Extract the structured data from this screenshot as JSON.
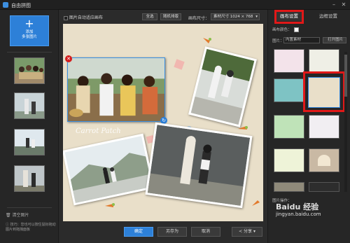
{
  "window": {
    "title": "自由拼图",
    "controls": [
      "minimize",
      "close"
    ]
  },
  "left_panel": {
    "add_button": {
      "icon": "plus-icon",
      "label": "添加\n多张图片"
    },
    "thumbnails": [
      "photo-group",
      "photo-statue-1",
      "photo-statue-2",
      "photo-statue-3"
    ],
    "clear_button": "清空图片",
    "tip": "技巧：您也可以按住鼠标拖动图片到拖拽面板"
  },
  "toolbar": {
    "auto_fill_checkbox": "图片自动适应画布",
    "select_all": "全选",
    "random_layout": "随机排版",
    "canvas_size_label": "画布尺寸：",
    "canvas_size_value": "素材尺寸 1024 × 768"
  },
  "bottom_bar": {
    "confirm": "确定",
    "save_as": "另存为",
    "cancel": "取消",
    "share": "分享"
  },
  "right_panel": {
    "tabs": [
      {
        "label": "画布设置",
        "active": true
      },
      {
        "label": "边框设置",
        "active": false
      }
    ],
    "bg_color_label": "画布颜色：",
    "bg_color_value": "#ffffff",
    "image_label": "图片：",
    "image_select": "内置素材",
    "open_image": "打开图片",
    "image_ops_label": "图片操作："
  },
  "canvas_text": "Carrot Patch",
  "watermark": {
    "brand": "Baidu 经验",
    "url": "jingyan.baidu.com"
  },
  "colors": {
    "accent": "#2d80d8",
    "highlight": "#e01818",
    "canvas": "#e9dfc9"
  }
}
